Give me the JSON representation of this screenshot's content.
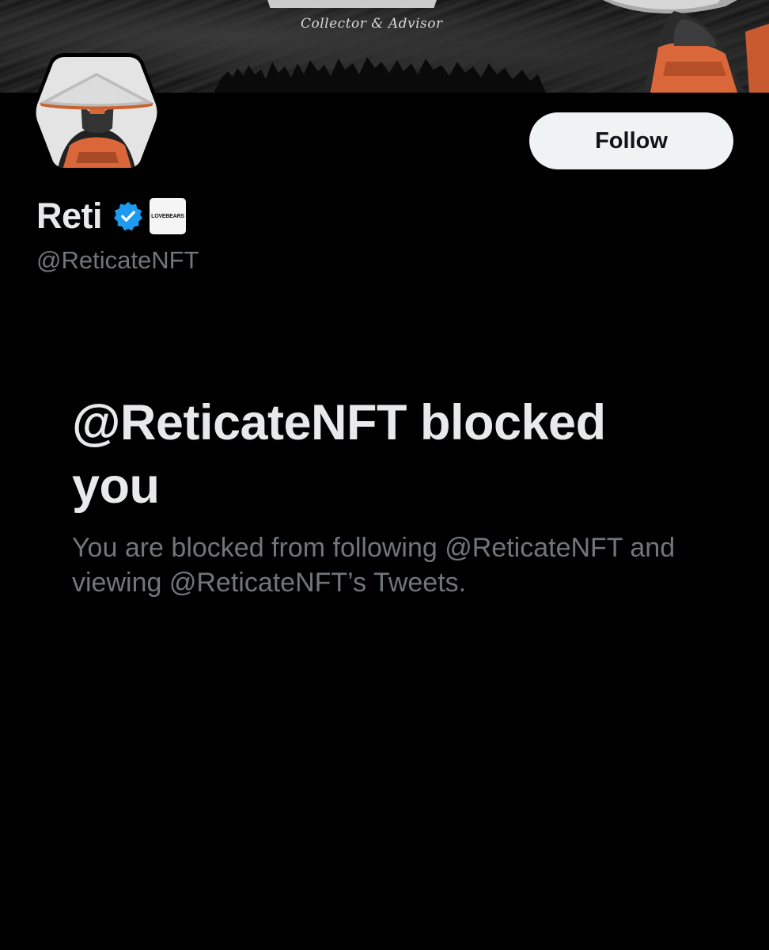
{
  "banner": {
    "tagline": "Collector & Advisor"
  },
  "profile": {
    "display_name": "Reti",
    "verified_icon": "verified-badge-icon",
    "affiliate_badge_text": "LOVEBEARS",
    "handle": "@ReticateNFT"
  },
  "actions": {
    "follow_label": "Follow"
  },
  "blocked": {
    "title": "@ReticateNFT blocked you",
    "description": "You are blocked from following @ReticateNFT and viewing @ReticateNFT’s Tweets."
  },
  "colors": {
    "background": "#000000",
    "primary_text": "#e7e9ea",
    "secondary_text": "#71767b",
    "verified_blue": "#1d9bf0",
    "follow_button_bg": "#eff3f4",
    "accent_orange": "#d9673a"
  }
}
